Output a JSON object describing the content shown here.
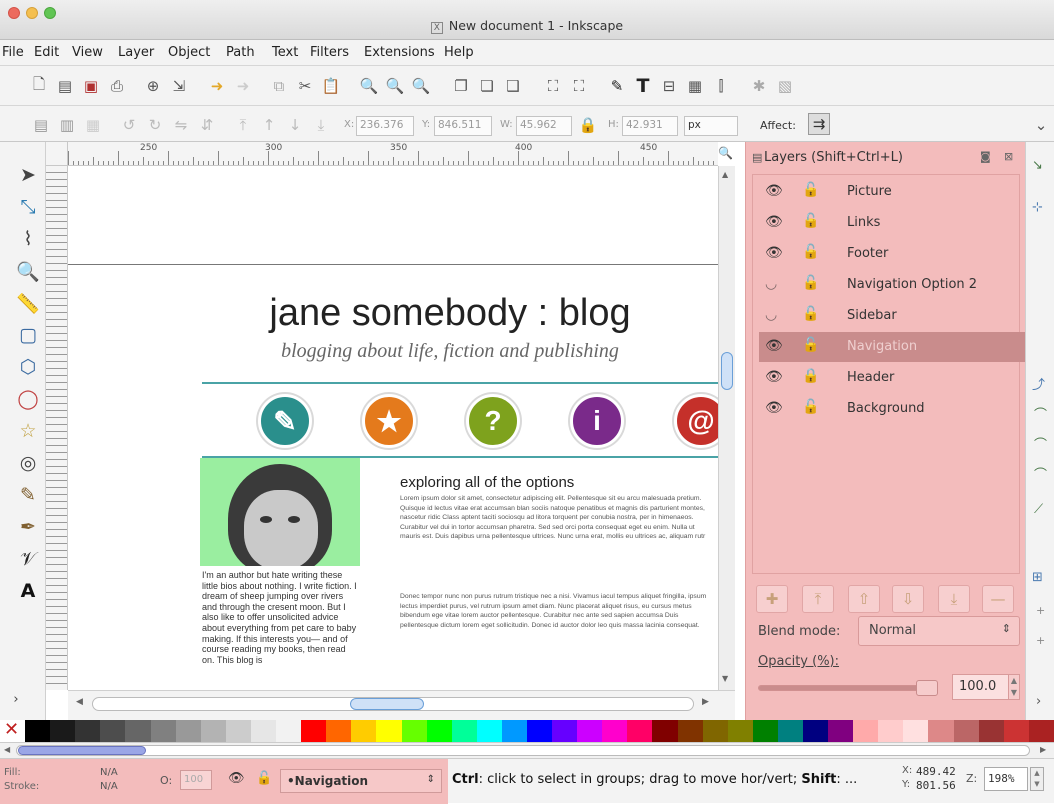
{
  "window": {
    "title": "New document 1 - Inkscape"
  },
  "menu": [
    "File",
    "Edit",
    "View",
    "Layer",
    "Object",
    "Path",
    "Text",
    "Filters",
    "Extensions",
    "Help"
  ],
  "controls": {
    "x_label": "X:",
    "x_value": "236.376",
    "y_label": "Y:",
    "y_value": "846.511",
    "w_label": "W:",
    "w_value": "45.962",
    "h_label": "H:",
    "h_value": "42.931",
    "unit": "px",
    "affect_label": "Affect:"
  },
  "ruler": {
    "labels": [
      "250",
      "300",
      "350",
      "400",
      "450"
    ]
  },
  "canvas": {
    "blog_title": "jane somebody : blog",
    "blog_subtitle": "blogging about life, fiction and publishing",
    "heading": "exploring all of the options",
    "sidebar_text": "I'm an author but hate writing these little bios about nothing. I write fiction. I dream of sheep jumping over rivers and through the cresent moon. But I also like to offer unsolicited advice about everything from pet care to baby making. If this interests you— and of course reading my books, then read on. This blog is",
    "body_para1": "Lorem ipsum dolor sit amet, consectetur adipiscing elit. Pellentesque sit eu arcu malesuada pretium. Quisque id lectus vitae erat accumsan blan sociis natoque penatibus et magnis dis parturient montes, nascetur ridic Class aptent taciti sociosqu ad litora torquent per conubia nostra, per in himenaeos. Curabitur vel dui in tortor accumsan pharetra. Sed sed orci porta consequat eget eu enim. Nulla ut mauris est. Duis dapibus urna pellentesque ultrices. Nunc urna erat, mollis eu ultrices ac, aliquam rutr",
    "body_para2": "Donec tempor nunc non purus rutrum tristique nec a nisi. Vivamus iacul tempus aliquet fringilla, ipsum lectus imperdiet purus, vel rutrum ipsum amet diam. Nunc placerat aliquet risus, eu cursus metus bibendum ege vitae lorem auctor pellentesque. Curabitur nec ante sed sapien accumsa Duis pellentesque dictum lorem eget sollicitudin. Donec id auctor dolor leo quis massa lacinia consequat.",
    "icons": [
      {
        "name": "pencil",
        "color": "#2a8f8c",
        "glyph": "✎"
      },
      {
        "name": "star",
        "color": "#e47a1c",
        "glyph": "★"
      },
      {
        "name": "question",
        "color": "#7ea21d",
        "glyph": "?"
      },
      {
        "name": "info",
        "color": "#7a2a8a",
        "glyph": "i"
      },
      {
        "name": "at",
        "color": "#c5302a",
        "glyph": "@"
      }
    ]
  },
  "layers_panel": {
    "title": "Layers (Shift+Ctrl+L)",
    "layers": [
      {
        "name": "Picture",
        "visible": true,
        "locked": false
      },
      {
        "name": "Links",
        "visible": true,
        "locked": false
      },
      {
        "name": "Footer",
        "visible": true,
        "locked": false
      },
      {
        "name": "Navigation Option 2",
        "visible": false,
        "locked": false
      },
      {
        "name": "Sidebar",
        "visible": false,
        "locked": false
      },
      {
        "name": "Navigation",
        "visible": true,
        "locked": false,
        "selected": true
      },
      {
        "name": "Header",
        "visible": true,
        "locked": true
      },
      {
        "name": "Background",
        "visible": true,
        "locked": false
      }
    ],
    "blend_label": "Blend mode:",
    "blend_value": "Normal",
    "opacity_label": "Opacity (%):",
    "opacity_value": "100.0",
    "opacity": 1.0
  },
  "status": {
    "fill_label": "Fill:",
    "fill_value": "N/A",
    "stroke_label": "Stroke:",
    "stroke_value": "N/A",
    "o_label": "O:",
    "o_value": "100",
    "layer": "•Navigation",
    "hint_prefix": "Ctrl",
    "hint_mid": ": click to select in groups; drag to move hor/vert; ",
    "hint_shift": "Shift",
    "hint_end": ": ...",
    "x_label": "X:",
    "x_value": "489.42",
    "y_label": "Y:",
    "y_value": "801.56",
    "zoom_label": "Z:",
    "zoom_value": "198%"
  },
  "palette": [
    "#ffffff",
    "#000000",
    "#1a1a1a",
    "#333333",
    "#4d4d4d",
    "#666666",
    "#808080",
    "#999999",
    "#b3b3b3",
    "#cccccc",
    "#e6e6e6",
    "#f2f2f2",
    "#ff0000",
    "#ff6600",
    "#ffcc00",
    "#ffff00",
    "#66ff00",
    "#00ff00",
    "#00ff99",
    "#00ffff",
    "#0099ff",
    "#0000ff",
    "#6600ff",
    "#cc00ff",
    "#ff00cc",
    "#ff0066",
    "#800000",
    "#803300",
    "#806600",
    "#808000",
    "#008000",
    "#008080",
    "#000080",
    "#800080",
    "#ffaaaa",
    "#ffcccc",
    "#ffe0e0",
    "#dd8888",
    "#bb6666",
    "#993333",
    "#cc3333",
    "#aa2222"
  ]
}
